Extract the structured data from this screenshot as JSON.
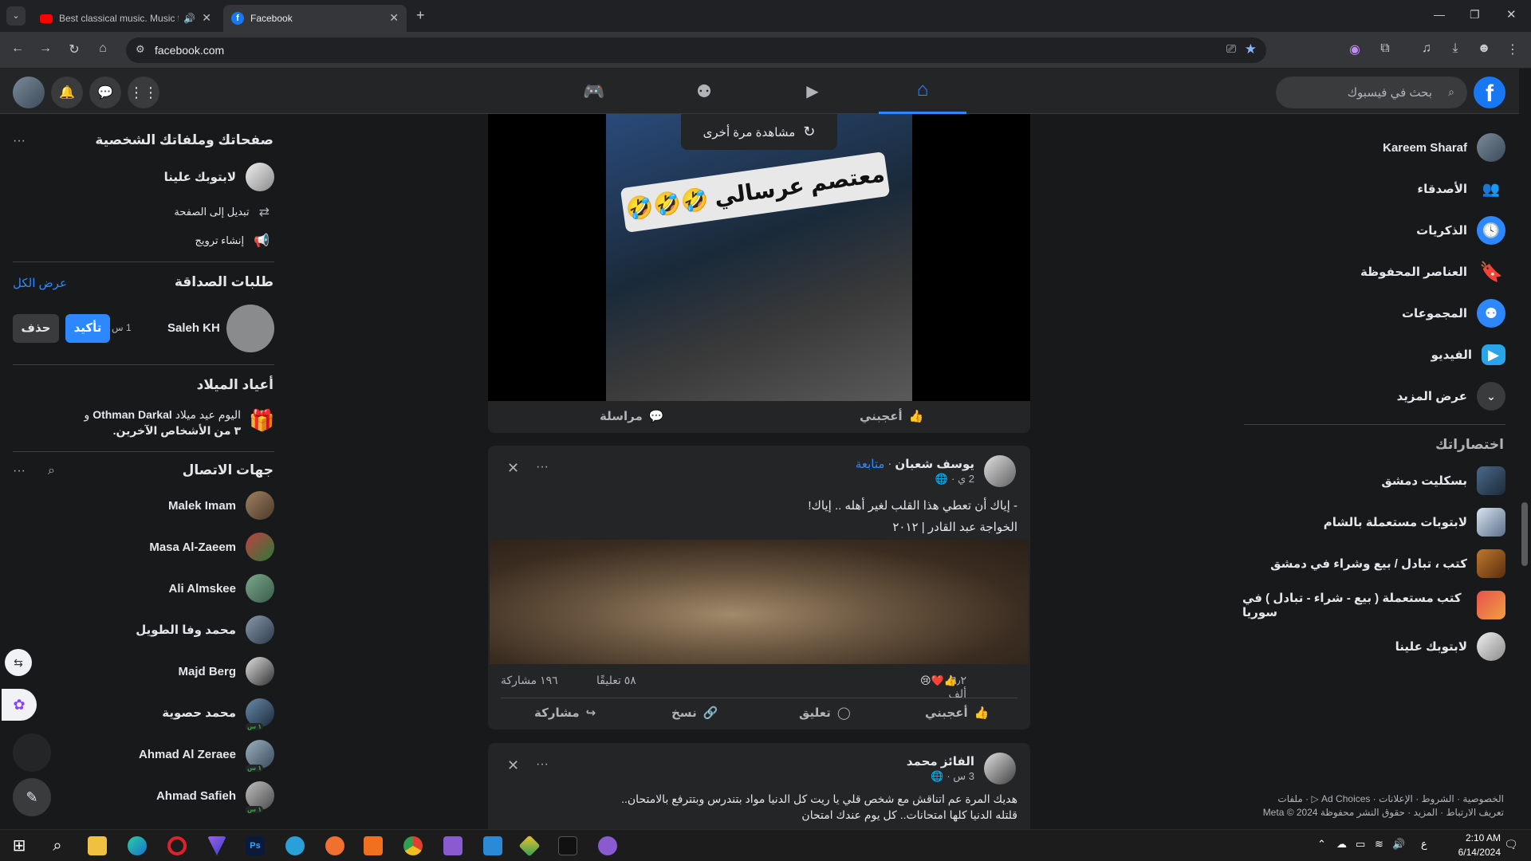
{
  "browser": {
    "tabs": [
      {
        "title": "Best classical music. Music f",
        "active": false
      },
      {
        "title": "Facebook",
        "active": true
      }
    ],
    "new_tab": "+",
    "url": "facebook.com"
  },
  "header": {
    "search_placeholder": "بحث في فيسبوك",
    "nav_tabs": [
      "home",
      "watch",
      "groups",
      "gaming"
    ]
  },
  "right_sidebar": {
    "items": [
      {
        "label": "Kareem Sharaf",
        "icon": "profile-avatar"
      },
      {
        "label": "الأصدقاء",
        "icon": "friends-icon"
      },
      {
        "label": "الذكريات",
        "icon": "memories-icon"
      },
      {
        "label": "العناصر المحفوظة",
        "icon": "saved-icon"
      },
      {
        "label": "المجموعات",
        "icon": "groups-icon"
      },
      {
        "label": "الفيديو",
        "icon": "video-icon"
      },
      {
        "label": "عرض المزيد",
        "icon": "chevron-down-icon"
      }
    ],
    "shortcuts_title": "اختصاراتك",
    "shortcuts": [
      {
        "label": "بسكليت دمشق"
      },
      {
        "label": "لابتوبات مستعملة بالشام"
      },
      {
        "label": "كتب ، تبادل / بيع وشراء في دمشق"
      },
      {
        "label": "كتب مستعملة ( بيع - شراء - تبادل ) في سوريا"
      },
      {
        "label": "لابتوبك علينا"
      }
    ],
    "footer_line1": "الخصوصية · الشروط · الإعلانات · Ad Choices ▷ · ملفات",
    "footer_line2": "تعريف الارتباط · المزيد · حقوق النشر محفوظة Meta © 2024"
  },
  "left_column": {
    "pages_title": "صفحاتك وملفاتك الشخصية",
    "page_name": "لابتوبك علينا",
    "switch_label": "تبديل إلى الصفحة",
    "promote_label": "إنشاء ترويج",
    "requests_title": "طلبات الصداقة",
    "see_all": "عرض الكل",
    "request": {
      "name": "Saleh KH",
      "time": "1 س",
      "confirm": "تأكيد",
      "delete": "حذف"
    },
    "birthdays_title": "أعياد الميلاد",
    "birthday_prefix": "اليوم عيد ميلاد",
    "birthday_name": "Othman Darkal",
    "birthday_suffix": "و",
    "birthday_line2": "٣ من الأشخاص الآخرين.",
    "contacts_title": "جهات الاتصال",
    "contacts": [
      {
        "name": "Malek Imam",
        "badge": ""
      },
      {
        "name": "Masa Al-Zaeem",
        "badge": ""
      },
      {
        "name": "Ali Almskee",
        "badge": ""
      },
      {
        "name": "محمد وفا الطويل",
        "badge": ""
      },
      {
        "name": "Majd Berg",
        "badge": ""
      },
      {
        "name": "محمد حصوية",
        "badge": "١ س"
      },
      {
        "name": "Ahmad Al Zeraee",
        "badge": "١ س"
      },
      {
        "name": "Ahmad Safieh",
        "badge": "١ س"
      }
    ]
  },
  "feed": {
    "post0": {
      "replay": "مشاهدة مرة أخرى",
      "overlay_text": "معتصم عرسالي",
      "like": "أعجبني",
      "message": "مراسلة"
    },
    "post1": {
      "author": "يوسف شعبان",
      "follow": "متابعة",
      "time": "2 ي ·",
      "text_line1": "- إياك أن تعطي هذا القلب لغير أهله .. إياك!",
      "text_line2": "الخواجة عبد القادر | ٢٠١٢",
      "reactions": "٦٫٢ ألف",
      "comments": "٥٨ تعليقًا",
      "shares": "١٩٦ مشاركة",
      "like": "أعجبني",
      "comment": "تعليق",
      "copy": "نسخ",
      "share": "مشاركة"
    },
    "post2": {
      "author": "الفائز محمد",
      "time": "3 س ·",
      "text_line1": "هديك المرة عم اتناقش مع شخص قلي يا ريت كل الدنيا مواد بتندرس وبتترفع بالامتحان..",
      "text_line2": "قلتله الدنيا كلها امتحانات.. كل يوم عندك امتحان"
    }
  },
  "taskbar": {
    "time": "2:10 AM",
    "date": "6/14/2024",
    "lang": "ع"
  },
  "colors": {
    "accent": "#2d88ff",
    "bg": "#18191a",
    "surface": "#242526"
  }
}
